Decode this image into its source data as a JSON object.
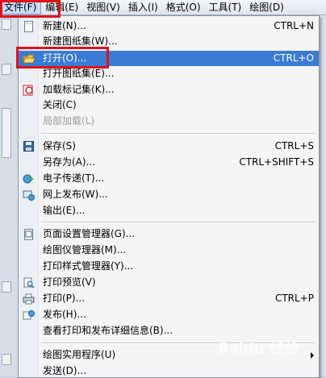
{
  "menubar": {
    "items": [
      {
        "label": "文件(F)"
      },
      {
        "label": "编辑(E)"
      },
      {
        "label": "视图(V)"
      },
      {
        "label": "插入(I)"
      },
      {
        "label": "格式(O)"
      },
      {
        "label": "工具(T)"
      },
      {
        "label": "绘图(D)"
      }
    ]
  },
  "file_menu": {
    "items": [
      {
        "label": "新建(N)...",
        "shortcut": "CTRL+N",
        "icon": "new-file-icon"
      },
      {
        "label": "新建图纸集(W)...",
        "shortcut": "",
        "icon": ""
      },
      {
        "label": "打开(O)...",
        "shortcut": "CTRL+O",
        "icon": "open-folder-icon"
      },
      {
        "label": "打开图纸集(E)...",
        "shortcut": "",
        "icon": ""
      },
      {
        "label": "加载标记集(K)...",
        "shortcut": "",
        "icon": "markup-icon"
      },
      {
        "label": "关闭(C)",
        "shortcut": "",
        "icon": ""
      },
      {
        "label": "局部加载(L)",
        "shortcut": "",
        "icon": ""
      },
      {
        "label": "保存(S)",
        "shortcut": "CTRL+S",
        "icon": "save-icon"
      },
      {
        "label": "另存为(A)...",
        "shortcut": "CTRL+SHIFT+S",
        "icon": ""
      },
      {
        "label": "电子传递(T)...",
        "shortcut": "",
        "icon": "etransmit-icon"
      },
      {
        "label": "网上发布(W)...",
        "shortcut": "",
        "icon": "publish-web-icon"
      },
      {
        "label": "输出(E)...",
        "shortcut": "",
        "icon": ""
      },
      {
        "label": "页面设置管理器(G)...",
        "shortcut": "",
        "icon": "page-setup-icon"
      },
      {
        "label": "绘图仪管理器(M)...",
        "shortcut": "",
        "icon": ""
      },
      {
        "label": "打印样式管理器(Y)...",
        "shortcut": "",
        "icon": ""
      },
      {
        "label": "打印预览(V)",
        "shortcut": "",
        "icon": "print-preview-icon"
      },
      {
        "label": "打印(P)...",
        "shortcut": "CTRL+P",
        "icon": "print-icon"
      },
      {
        "label": "发布(H)...",
        "shortcut": "",
        "icon": "publish-icon"
      },
      {
        "label": "查看打印和发布详细信息(B)...",
        "shortcut": "",
        "icon": ""
      },
      {
        "label": "绘图实用程序(U)",
        "shortcut": "",
        "icon": ""
      },
      {
        "label": "发送(D)...",
        "shortcut": "",
        "icon": ""
      }
    ]
  },
  "watermark": "Baidu 经验",
  "colors": {
    "highlight": "#3a7bd5",
    "annotation_red": "#e0121c"
  }
}
